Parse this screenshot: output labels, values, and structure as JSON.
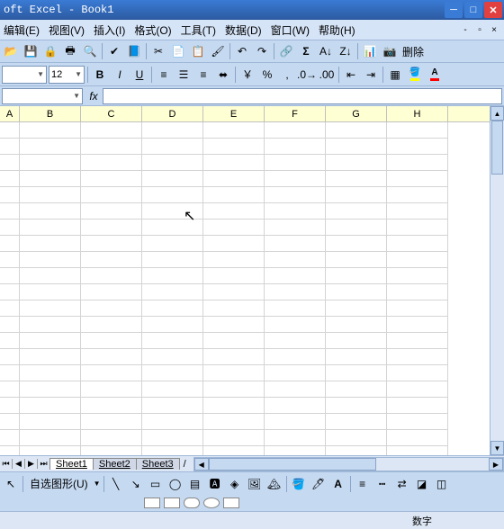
{
  "title": "oft Excel - Book1",
  "menus": [
    "编辑(E)",
    "视图(V)",
    "插入(I)",
    "格式(O)",
    "工具(T)",
    "数据(D)",
    "窗口(W)",
    "帮助(H)"
  ],
  "toolbar1": {
    "delete_label": "删除"
  },
  "format": {
    "font_size": "12",
    "bold": "B",
    "italic": "I",
    "underline": "U",
    "currency": "￥",
    "percent": "%",
    "comma": ",",
    "inc_dec": ".0",
    "dec_dec": ".00"
  },
  "formula": {
    "namebox": "",
    "fx": "fx",
    "value": ""
  },
  "columns": [
    "A",
    "B",
    "C",
    "D",
    "E",
    "F",
    "G",
    "H"
  ],
  "sheets": [
    "Sheet1",
    "Sheet2",
    "Sheet3"
  ],
  "draw": {
    "autoshape": "自选图形(U)"
  },
  "status": {
    "mode": "数字"
  }
}
